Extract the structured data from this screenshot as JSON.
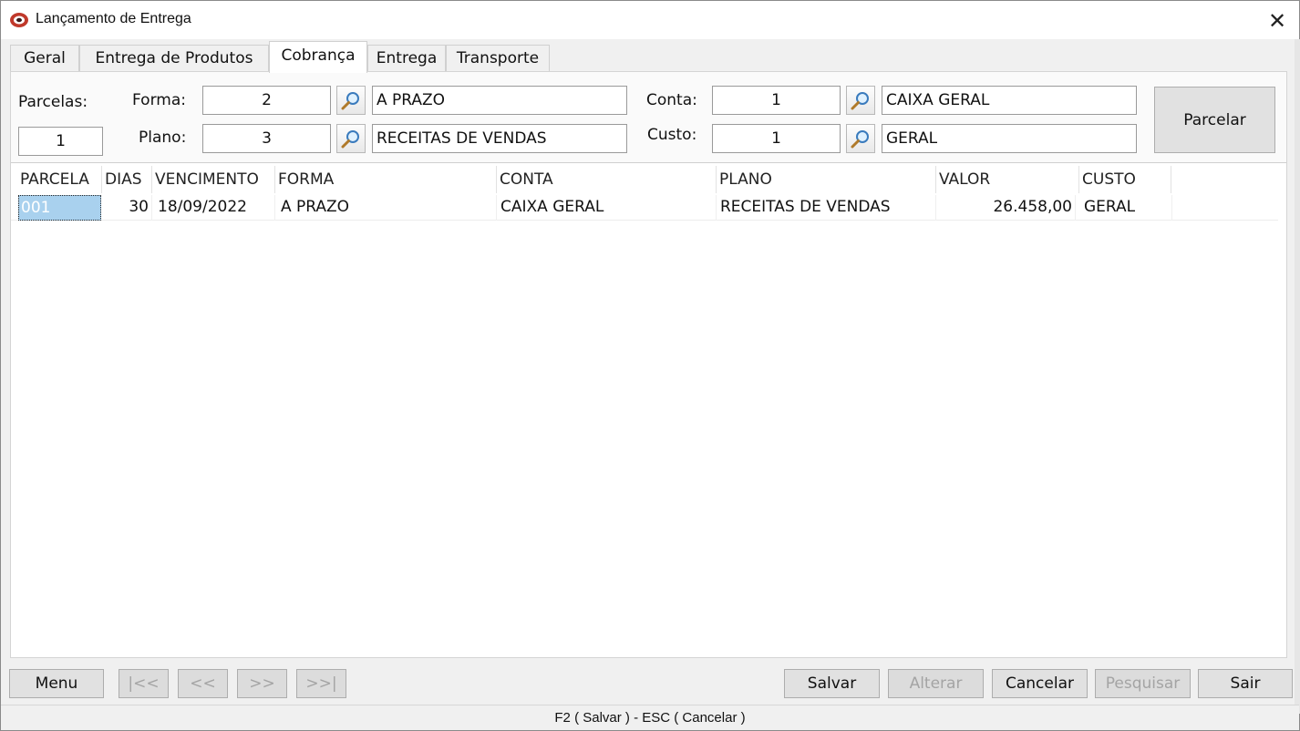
{
  "window": {
    "title": "Lançamento de Entrega",
    "close_label": "✕"
  },
  "tabs": [
    {
      "label": "Geral"
    },
    {
      "label": "Entrega de Produtos"
    },
    {
      "label": "Cobrança",
      "active": true
    },
    {
      "label": "Entrega"
    },
    {
      "label": "Transporte"
    }
  ],
  "form": {
    "parcelas_label": "Parcelas:",
    "parcelas_value": "1",
    "forma_label": "Forma:",
    "forma_code": "2",
    "forma_desc": "A PRAZO",
    "plano_label": "Plano:",
    "plano_code": "3",
    "plano_desc": "RECEITAS DE VENDAS",
    "conta_label": "Conta:",
    "conta_code": "1",
    "conta_desc": "CAIXA GERAL",
    "custo_label": "Custo:",
    "custo_code": "1",
    "custo_desc": "GERAL",
    "parcelar_label": "Parcelar"
  },
  "grid": {
    "columns": [
      "PARCELA",
      "DIAS",
      "VENCIMENTO",
      "FORMA",
      "CONTA",
      "PLANO",
      "VALOR",
      "CUSTO"
    ],
    "rows": [
      {
        "parcela": "001",
        "dias": "30",
        "vencimento": "18/09/2022",
        "forma": "A PRAZO",
        "conta": "CAIXA GERAL",
        "plano": "RECEITAS DE VENDAS",
        "valor": "26.458,00",
        "custo": "GERAL"
      }
    ]
  },
  "nav": {
    "menu": "Menu",
    "first": "|<<",
    "prev": "<<",
    "next": ">>",
    "last": ">>|",
    "salvar": "Salvar",
    "alterar": "Alterar",
    "cancelar": "Cancelar",
    "pesquisar": "Pesquisar",
    "sair": "Sair"
  },
  "status": {
    "text": "F2 ( Salvar )  -  ESC ( Cancelar )"
  },
  "colors": {
    "selection": "#a9d1ee",
    "window_bg": "#f0f0f0",
    "button_bg": "#e1e1e1",
    "disabled_text": "#a4a4a4"
  }
}
